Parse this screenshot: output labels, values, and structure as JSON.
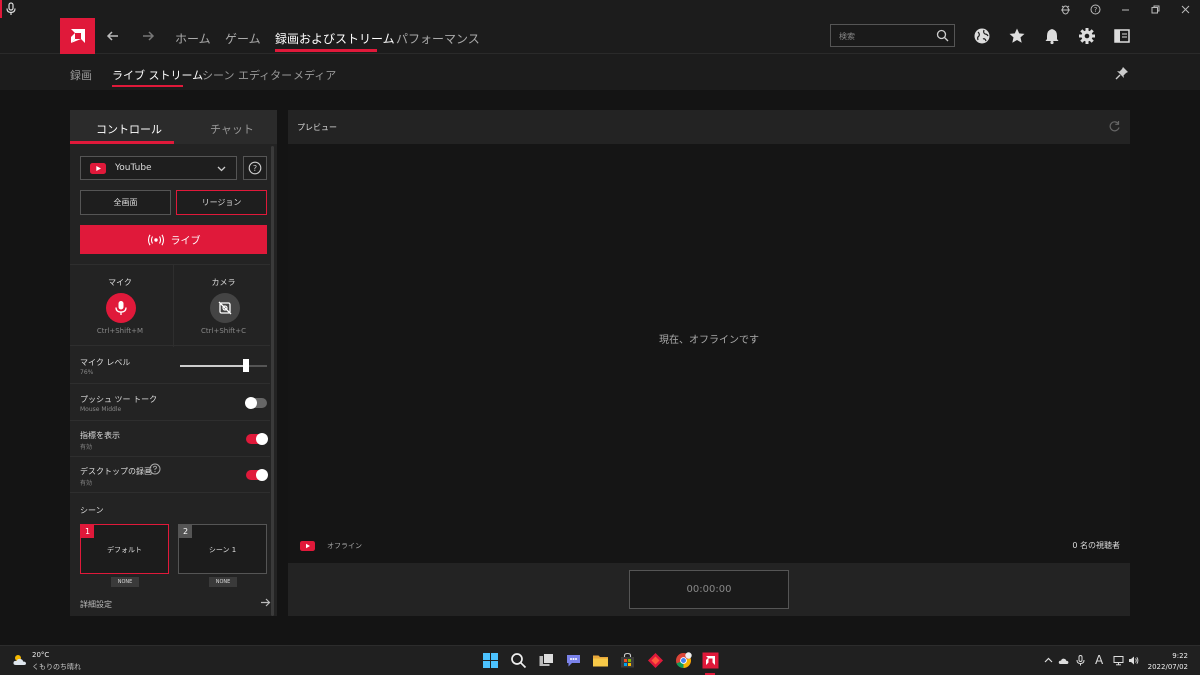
{
  "header": {
    "nav_items": [
      "ホーム",
      "ゲーム",
      "録画およびストリーム",
      "パフォーマンス"
    ],
    "active_nav": "録画およびストリーム",
    "search_placeholder": "検索"
  },
  "subnav": {
    "items": [
      "録画",
      "ライブ ストリーム",
      "シーン エディター",
      "メディア"
    ],
    "active": "ライブ ストリーム"
  },
  "left_panel": {
    "tabs": [
      "コントロール",
      "チャット"
    ],
    "active_tab": "コントロール",
    "platform": "YouTube",
    "help_label": "?",
    "capture_modes": [
      "全画面",
      "リージョン"
    ],
    "selected_mode": "リージョン",
    "live_button": "ライブ",
    "mic": {
      "label": "マイク",
      "shortcut": "Ctrl+Shift+M"
    },
    "camera": {
      "label": "カメラ",
      "shortcut": "Ctrl+Shift+C"
    },
    "mic_level": {
      "label": "マイク レベル",
      "value": "76%",
      "fraction": 0.76
    },
    "push_to_talk": {
      "label": "プッシュ ツー トーク",
      "sub": "Mouse Middle",
      "on": false
    },
    "show_metrics": {
      "label": "指標を表示",
      "sub": "有効",
      "on": true
    },
    "desktop_record": {
      "label": "デスクトップの録画",
      "sub": "有効",
      "on": true
    },
    "scenes_title": "シーン",
    "scenes": [
      {
        "num": "1",
        "name": "デフォルト",
        "badge": "NONE"
      },
      {
        "num": "2",
        "name": "シーン 1",
        "badge": "NONE"
      }
    ],
    "advanced": "詳細設定"
  },
  "preview": {
    "title": "プレビュー",
    "message": "現在、オフラインです",
    "status": "オフライン",
    "viewers": "0 名の視聴者",
    "timer": "00:00:00"
  },
  "taskbar": {
    "temperature": "20°C",
    "condition": "くもりのち晴れ",
    "ime": "A",
    "time": "9:22",
    "date": "2022/07/02"
  },
  "colors": {
    "accent": "#e0193a",
    "background": "#141414",
    "panel": "#232323"
  }
}
